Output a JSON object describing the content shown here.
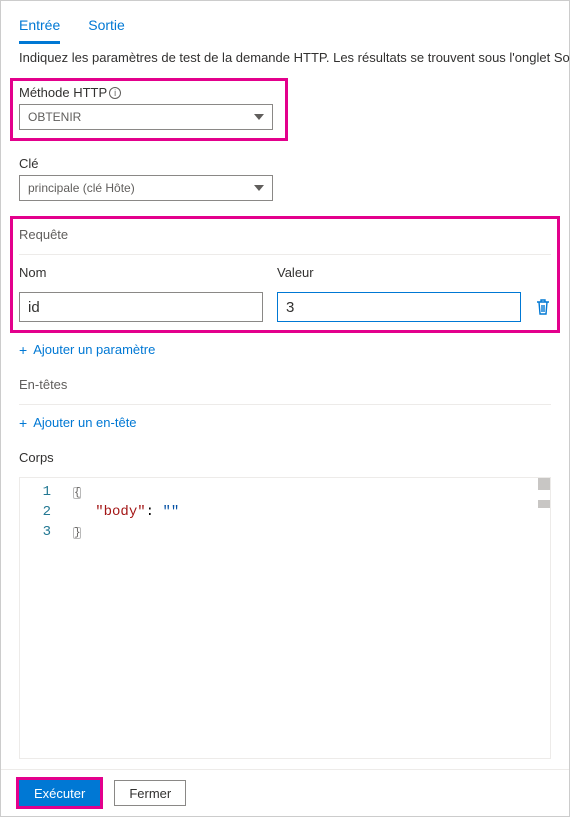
{
  "tabs": {
    "input": "Entrée",
    "output": "Sortie"
  },
  "description": "Indiquez les paramètres de test de la demande HTTP. Les résultats se trouvent sous l'onglet Sortie.",
  "http_method": {
    "label": "Méthode HTTP",
    "value": "OBTENIR"
  },
  "key": {
    "label": "Clé",
    "value": "principale (clé Hôte)"
  },
  "query": {
    "title": "Requête",
    "name_header": "Nom",
    "value_header": "Valeur",
    "rows": [
      {
        "name": "id",
        "value": "3"
      }
    ],
    "add_label": "Ajouter un paramètre"
  },
  "headers": {
    "title": "En-têtes",
    "add_label": "Ajouter un en-tête"
  },
  "body": {
    "title": "Corps",
    "lines": {
      "l1": "{",
      "l2_key": "\"body\"",
      "l2_colon": ": ",
      "l2_val": "\"\"",
      "l3": "}"
    },
    "gutter": [
      "1",
      "2",
      "3"
    ]
  },
  "footer": {
    "run": "Exécuter",
    "close": "Fermer"
  }
}
